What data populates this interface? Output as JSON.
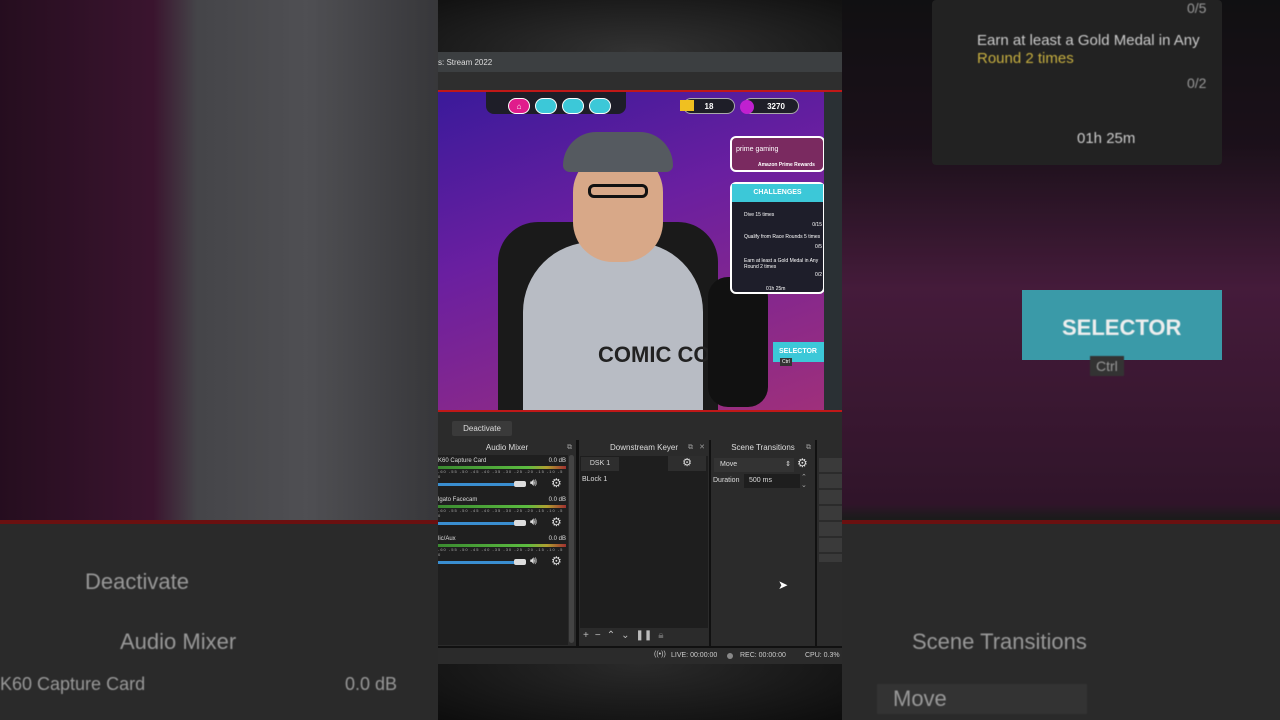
{
  "background_left": {
    "deactivate": "Deactivate",
    "audio_mixer": "Audio Mixer",
    "track": "K60 Capture Card",
    "db": "0.0 dB"
  },
  "background_right": {
    "progress1": "0/5",
    "challenge": "Earn at least a Gold Medal in Any",
    "challenge2": "Round 2 times",
    "progress2": "0/2",
    "timer": "01h 25m",
    "selector": "SELECTOR",
    "ctrl": "Ctrl",
    "scene_transitions": "Scene Transitions",
    "move": "Move"
  },
  "window": {
    "title": "s: Stream 2022"
  },
  "preview": {
    "crowns": "18",
    "coins": "3270",
    "prime": "prime gaming",
    "prime_sub": "Amazon Prime Rewards",
    "challenges_title": "CHALLENGES",
    "challenges": [
      {
        "text": "Dive 15 times",
        "progress": "0/15"
      },
      {
        "text": "Qualify from Race Rounds 5 times",
        "progress": "0/5"
      },
      {
        "text": "Earn at least a Gold Medal in Any Round 2 times",
        "progress": "0/2"
      }
    ],
    "timer": "01h 25m",
    "selector": "SELECTOR",
    "ctrl": "Ctrl"
  },
  "controls": {
    "deactivate": "Deactivate"
  },
  "audio_mixer": {
    "title": "Audio Mixer",
    "scale": "-60 -55 -50 -45 -40 -35 -30 -25 -20 -15 -10 -5 0",
    "tracks": [
      {
        "name": "K60 Capture Card",
        "db": "0.0 dB"
      },
      {
        "name": "lgato Facecam",
        "db": "0.0 dB"
      },
      {
        "name": "lic/Aux",
        "db": "0.0 dB"
      }
    ]
  },
  "dsk": {
    "title": "Downstream Keyer",
    "tab": "DSK 1",
    "item": "BLock 1"
  },
  "transitions": {
    "title": "Scene Transitions",
    "transition": "Move",
    "duration_label": "Duration",
    "duration": "500 ms"
  },
  "status": {
    "live": "LIVE: 00:00:00",
    "rec": "REC: 00:00:00",
    "cpu": "CPU: 0.3%"
  },
  "colors": {
    "accent_red": "#c01818",
    "slider_blue": "#3a8ed0"
  }
}
